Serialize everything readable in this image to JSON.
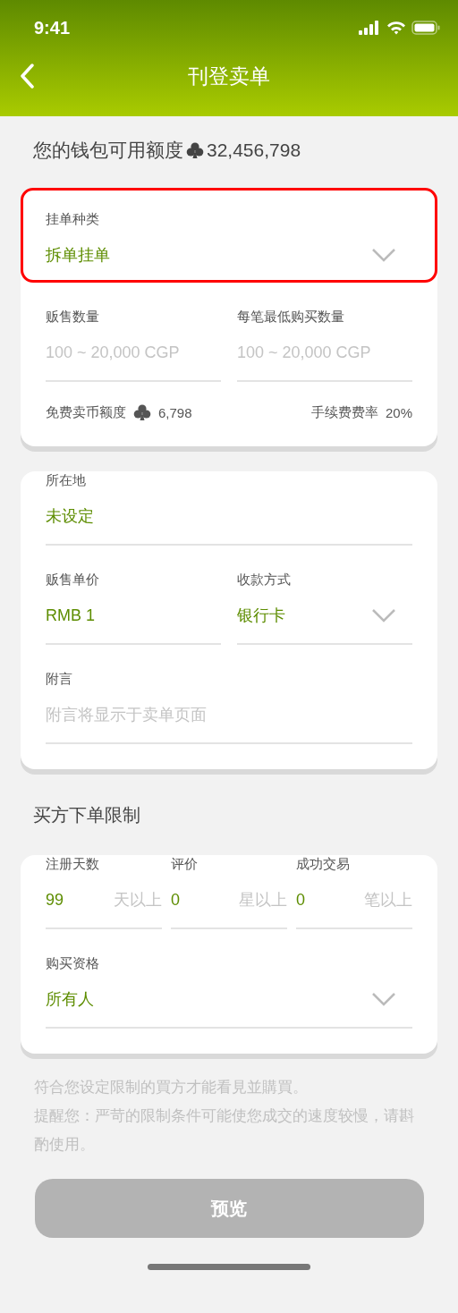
{
  "status_bar": {
    "time": "9:41"
  },
  "nav": {
    "title": "刊登卖单"
  },
  "wallet": {
    "label": "您的钱包可用额度",
    "amount": "32,456,798"
  },
  "cards": [
    {
      "rows": [
        [
          {
            "kind": "select",
            "label": "挂单种类",
            "value": "拆单挂单",
            "highlighted": true
          }
        ],
        [
          {
            "kind": "input",
            "label": "贩售数量",
            "placeholder": "100 ~ 20,000 CGP"
          },
          {
            "kind": "input",
            "label": "每笔最低购买数量",
            "placeholder": "100 ~ 20,000 CGP"
          }
        ]
      ],
      "info": [
        {
          "label": "免费卖币额度",
          "amount": "6,798",
          "kind": "coins"
        },
        {
          "label": "手续费费率",
          "amount": "20%",
          "kind": "plain"
        }
      ]
    },
    {
      "rows": [
        [
          {
            "kind": "input",
            "label": "所在地",
            "value": "未设定"
          }
        ],
        [
          {
            "kind": "input",
            "label": "贩售单价",
            "value": "RMB 1"
          },
          {
            "kind": "select",
            "label": "收款方式",
            "value": "银行卡"
          }
        ],
        [
          {
            "kind": "input",
            "label": "附言",
            "placeholder": "附言将显示于卖单页面"
          }
        ]
      ]
    },
    {
      "title": "买方下单限制",
      "rows": [
        [
          {
            "kind": "input",
            "label": "注册天数",
            "value": "99",
            "suffix": "天以上"
          },
          {
            "kind": "input",
            "label": "评价",
            "value": "0",
            "suffix": "星以上"
          },
          {
            "kind": "input",
            "label": "成功交易",
            "value": "0",
            "suffix": "笔以上"
          }
        ],
        [
          {
            "kind": "select",
            "label": "购买资格",
            "value": "所有人"
          }
        ]
      ]
    }
  ],
  "notes": [
    "符合您设定限制的買方才能看見並購買。",
    "提醒您：严苛的限制条件可能使您成交的速度较慢，请斟酌使用。"
  ],
  "preview_button": {
    "label": "预览",
    "disabled": true
  }
}
